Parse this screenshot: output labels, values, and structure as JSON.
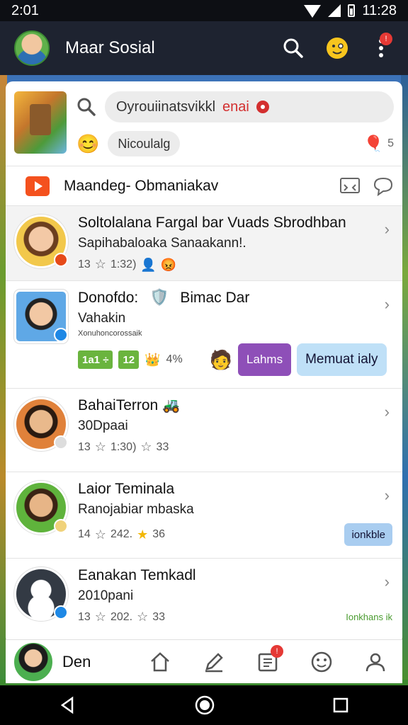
{
  "status_bar": {
    "time": "2:01",
    "clock": "11:28"
  },
  "app_bar": {
    "title": "Maar Sosial",
    "notification_count": "!"
  },
  "composer": {
    "search_text": "Oyrouiinatsvikkl",
    "search_tag": "enai",
    "mood_label": "Nicoulalg",
    "count": "5"
  },
  "section": {
    "title": "Maandeg- Obmaniakav"
  },
  "feed": [
    {
      "name": "Soltolalana Fargal bar Vuads Sbrodhban",
      "subtitle": "Sapihabaloaka Sanaakann!.",
      "meta_a": "13",
      "meta_b": "1:32)",
      "avatar_color": "#f2c84b"
    },
    {
      "name": "Donofdo:",
      "name_extra": "Bimac Dar",
      "subtitle": "Vahakin",
      "small_text": "Xonuhoncorossaik",
      "tag1": "1a1 ÷",
      "tag2": "12",
      "tag3": "4%",
      "chip_purple": "Lahms",
      "chip_blue": "Memuat ialy",
      "avatar_color": "#5fa8e6"
    },
    {
      "name": "BahaiTerron",
      "subtitle": "30Dpaai",
      "meta_a": "13",
      "meta_b": "1:30)",
      "meta_c": "33",
      "avatar_color": "#e0813a"
    },
    {
      "name": "Laior Teminala",
      "subtitle": "Ranojabiar mbaska",
      "meta_a": "14",
      "meta_b": "242.",
      "meta_c": "36",
      "chip": "ionkble",
      "avatar_color": "#5fb33c"
    },
    {
      "name": "Eanakan Temkadl",
      "subtitle": "2010pani",
      "meta_a": "13",
      "meta_b": "202.",
      "meta_c": "33",
      "link_text": "Ionkhans ik",
      "avatar_color": "#333a44"
    }
  ],
  "bottom_nav": {
    "profile_name": "Den",
    "badge": "!"
  },
  "colors": {
    "accent_red": "#e53935",
    "green_tag": "#6ab43e",
    "purple_chip": "#8e4fb8",
    "blue_chip": "#bfe0f7"
  }
}
